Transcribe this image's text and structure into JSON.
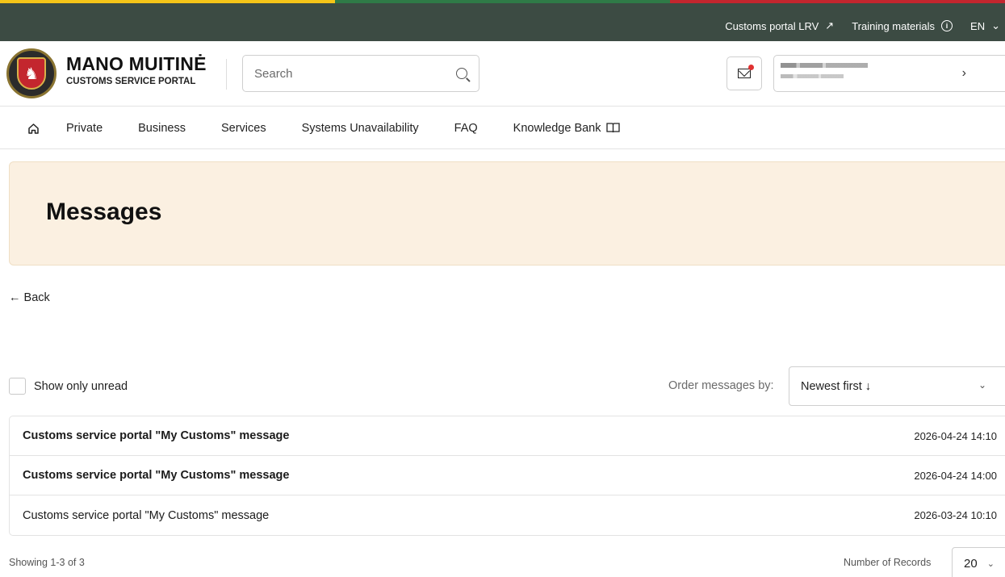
{
  "topbar": {
    "links": [
      {
        "label": "Customs portal LRV",
        "icon": "external-arrow-icon"
      },
      {
        "label": "Training materials",
        "icon": "info-icon"
      }
    ],
    "language": "EN"
  },
  "brand": {
    "title": "MANO MUITINĖ",
    "subtitle": "CUSTOMS SERVICE PORTAL",
    "colors": {
      "yellow": "#f5c518",
      "green": "#2f7a47",
      "red": "#c3262e",
      "topbar": "#3c4b43"
    }
  },
  "search": {
    "placeholder": "Search"
  },
  "nav": {
    "items": [
      "Private",
      "Business",
      "Services",
      "Systems Unavailability",
      "FAQ",
      "Knowledge Bank"
    ]
  },
  "page": {
    "title": "Messages",
    "back_label": "← Back",
    "banner_color": "#fbf0e1"
  },
  "filters": {
    "show_unread_label": "Show only unread",
    "order_label": "Order messages by:",
    "order_value": "Newest first ↓"
  },
  "messages": [
    {
      "subject": "Customs service portal \"My Customs\" message",
      "date": "2026-04-24 14:10",
      "unread": true
    },
    {
      "subject": "Customs service portal \"My Customs\" message",
      "date": "2026-04-24 14:00",
      "unread": true
    },
    {
      "subject": "Customs service portal \"My Customs\" message",
      "date": "2026-03-24 10:10",
      "unread": false
    }
  ],
  "pagination": {
    "showing": "Showing 1-3 of 3",
    "records_label": "Number of Records",
    "records_value": "20"
  }
}
